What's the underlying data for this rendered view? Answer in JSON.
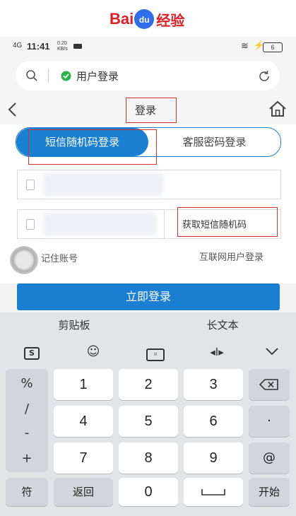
{
  "brand": {
    "bai": "Bai",
    "du": "du",
    "jingyan": "经验"
  },
  "status": {
    "carrier": "4G",
    "time": "11:41",
    "speed": "0.20 KB/s",
    "battery": "6"
  },
  "browser": {
    "page_title": "用户登录"
  },
  "header": {
    "title": "登录"
  },
  "tabs": {
    "sms": "短信随机码登录",
    "password": "客服密码登录"
  },
  "form": {
    "get_code": "获取短信随机码",
    "remember": "记住账号",
    "internet_login": "互联网用户登录",
    "submit": "立即登录"
  },
  "clipboard": {
    "paste": "剪贴板",
    "long_text": "长文本"
  },
  "toolbar": {
    "icons": [
      "baidu-s-icon",
      "emoji-icon",
      "keyboard-icon",
      "cursor-icon",
      "collapse-icon"
    ]
  },
  "keyboard": {
    "symbols": [
      "%",
      "/",
      "-",
      "+"
    ],
    "digits": [
      "1",
      "2",
      "3",
      "4",
      "5",
      "6",
      "7",
      "8",
      "9",
      "0"
    ],
    "dot": "·",
    "at": "@",
    "fu": "符",
    "back": "返回",
    "start": "开始"
  },
  "colors": {
    "accent": "#1a7fd0",
    "brand_red": "#de1f26",
    "brand_blue": "#2e6ee8",
    "highlight": "#d9302a"
  }
}
